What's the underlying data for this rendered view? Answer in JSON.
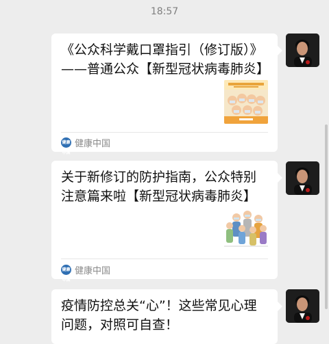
{
  "header": {
    "time": "18:57"
  },
  "messages": [
    {
      "title": "《公众科学戴口罩指引（修订版）》——普通公众【新型冠状病毒肺炎】",
      "source": "健康中国",
      "source_logo_text": "健康中国",
      "thumb": "masked-crowd-infographic"
    },
    {
      "title": "关于新修订的防护指南，公众特别注意篇来啦【新型冠状病毒肺炎】",
      "source": "健康中国",
      "source_logo_text": "健康中国",
      "thumb": "masked-people-illustration"
    },
    {
      "title": "疫情防控总关“心”！这些常见心理问题，对照可自查！",
      "source": "",
      "thumb": ""
    }
  ],
  "colors": {
    "background": "#ededed",
    "card": "#ffffff",
    "source_logo": "#2f6fb3"
  },
  "icons": [
    "avatar-photo",
    "source-logo",
    "article-thumbnail"
  ]
}
